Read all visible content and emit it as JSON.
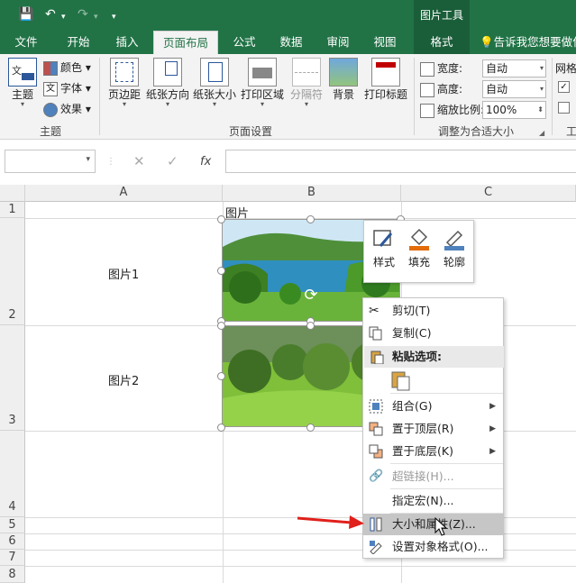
{
  "qat": {
    "save": "💾",
    "undo": "↶",
    "undo_arrow": "▾",
    "redo": "↷",
    "redo_arrow": "▾",
    "customize": "▾"
  },
  "context_header": "图片工具",
  "tabs": [
    "文件",
    "开始",
    "插入",
    "页面布局",
    "公式",
    "数据",
    "审阅",
    "视图",
    "格式"
  ],
  "tell_me": "告诉我您想要做什",
  "ribbon": {
    "theme_group": {
      "theme": "主题",
      "colors": "颜色",
      "fonts": "字体",
      "effects": "效果",
      "label": "主题"
    },
    "page_setup": {
      "buttons": [
        "页边距",
        "纸张方向",
        "纸张大小",
        "打印区域",
        "分隔符",
        "背景",
        "打印标题"
      ],
      "label": "页面设置"
    },
    "scale": {
      "width_label": "宽度:",
      "width_value": "自动",
      "height_label": "高度:",
      "height_value": "自动",
      "scale_label": "缩放比例:",
      "scale_value": "100%",
      "label": "调整为合适大小"
    },
    "sheet_options": {
      "label": "网格",
      "check1": "✓",
      "check2": "",
      "group_label": "工"
    }
  },
  "formula_bar": {
    "fx": "fx",
    "cancel": "✕",
    "confirm": "✓"
  },
  "columns": [
    "A",
    "B",
    "C"
  ],
  "rows": [
    "1",
    "2",
    "3",
    "4",
    "5",
    "6",
    "7",
    "8"
  ],
  "cells": {
    "b1": "图片",
    "a2": "图片1",
    "a3": "图片2"
  },
  "mini_toolbar": [
    "样式",
    "填充",
    "轮廓"
  ],
  "context_menu": {
    "cut": "剪切(T)",
    "copy": "复制(C)",
    "paste_options": "粘贴选项:",
    "group": "组合(G)",
    "bring_front": "置于顶层(R)",
    "send_back": "置于底层(K)",
    "hyperlink": "超链接(H)...",
    "assign_macro": "指定宏(N)...",
    "size_props": "大小和属性(Z)...",
    "format_object": "设置对象格式(O)..."
  }
}
